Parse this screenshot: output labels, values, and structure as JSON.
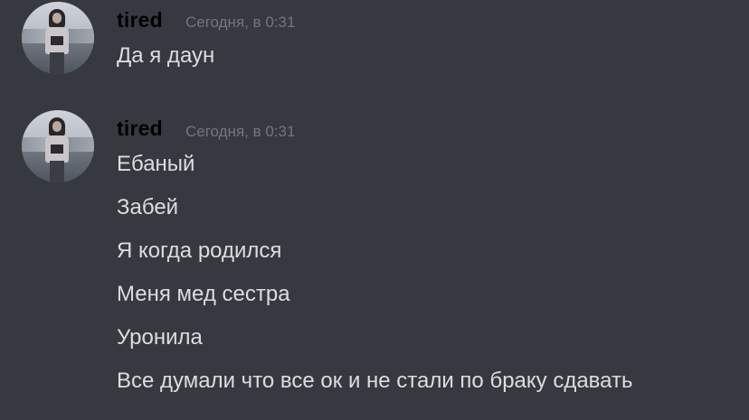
{
  "messages": [
    {
      "username": "tired",
      "timestamp": "Сегодня, в 0:31",
      "lines": [
        "Да я даун"
      ]
    },
    {
      "username": "tired",
      "timestamp": "Сегодня, в 0:31",
      "lines": [
        "Ебаный",
        "Забей",
        "Я когда родился",
        "Меня мед сестра",
        "Уронила",
        "Все думали что все ок и не стали по браку сдавать"
      ]
    }
  ]
}
